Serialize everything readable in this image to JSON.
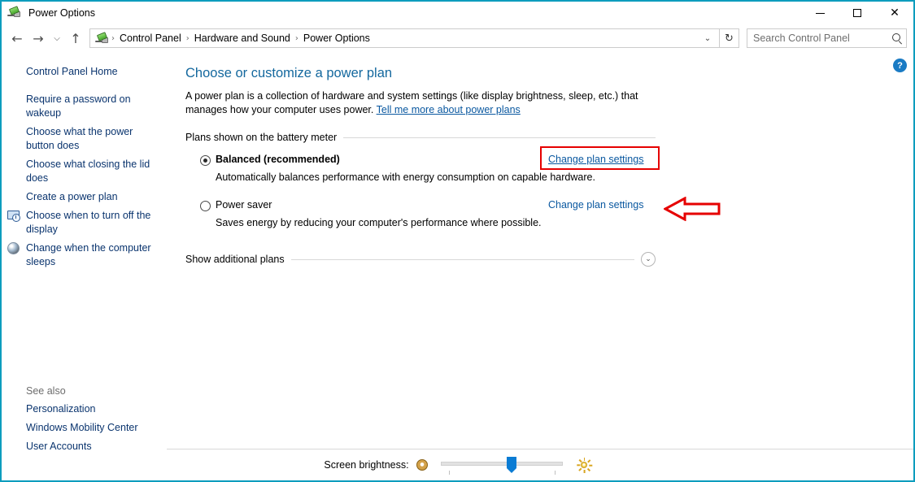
{
  "window": {
    "title": "Power Options",
    "app_icon": "power-plug-battery-icon",
    "border_color": "#0d9dbd",
    "controls": {
      "minimize": "minimize-icon",
      "maximize": "maximize-icon",
      "close": "close-icon"
    }
  },
  "addressbar": {
    "back": "back-arrow-icon",
    "forward": "forward-arrow-icon",
    "recent": "recent-locations-chevron-icon",
    "up": "up-arrow-icon",
    "breadcrumbs": [
      "Control Panel",
      "Hardware and Sound",
      "Power Options"
    ],
    "separator": "›",
    "dropdown": "⌄",
    "refresh": "↻",
    "search": {
      "placeholder": "Search Control Panel",
      "value": "",
      "icon": "search-icon"
    }
  },
  "sidebar": {
    "home_label": "Control Panel Home",
    "items": [
      {
        "label": "Require a password on wakeup",
        "icon": null
      },
      {
        "label": "Choose what the power button does",
        "icon": null
      },
      {
        "label": "Choose what closing the lid does",
        "icon": null
      },
      {
        "label": "Create a power plan",
        "icon": null
      },
      {
        "label": "Choose when to turn off the display",
        "icon": "monitor-clock-icon"
      },
      {
        "label": "Change when the computer sleeps",
        "icon": "sleep-sphere-icon"
      }
    ],
    "see_also": {
      "heading": "See also",
      "items": [
        "Personalization",
        "Windows Mobility Center",
        "User Accounts"
      ]
    }
  },
  "main": {
    "title": "Choose or customize a power plan",
    "description_part1": "A power plan is a collection of hardware and system settings (like display brightness, sleep, etc.) that manages how your computer uses power.",
    "description_link": "Tell me more about power plans",
    "group_label": "Plans shown on the battery meter",
    "plans": [
      {
        "name": "Balanced (recommended)",
        "description": "Automatically balances performance with energy consumption on capable hardware.",
        "selected": true,
        "bold": true,
        "change_link": "Change plan settings",
        "highlighted": true
      },
      {
        "name": "Power saver",
        "description": "Saves energy by reducing your computer's performance where possible.",
        "selected": false,
        "bold": false,
        "change_link": "Change plan settings",
        "highlighted": false
      }
    ],
    "show_additional": {
      "label": "Show additional plans",
      "chevron": "⌄",
      "expanded": false
    },
    "help_button": "?"
  },
  "brightness": {
    "label": "Screen brightness:",
    "dim_icon": "dim-sun-icon",
    "bright_icon": "bright-sun-icon",
    "value_percent": 58
  },
  "annotation": {
    "highlight_color": "#e60000",
    "arrow_direction": "left",
    "target": "Change plan settings"
  }
}
